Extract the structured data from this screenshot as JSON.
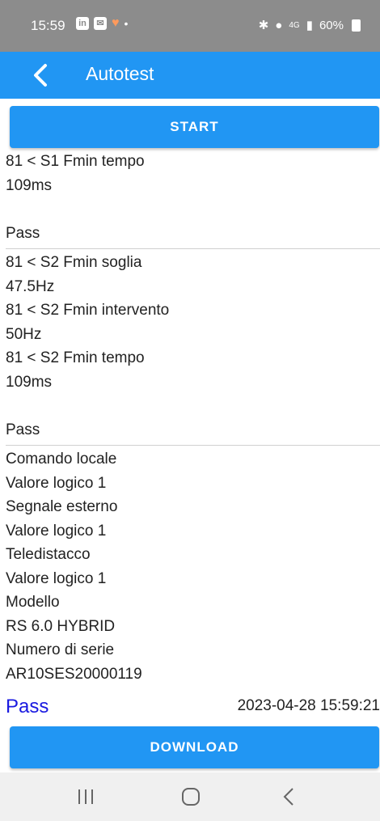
{
  "status_bar": {
    "time": "15:59",
    "left_icons": [
      "linkedin-icon",
      "message-icon",
      "heart-icon",
      "dot-icon"
    ],
    "signal_text": "4G",
    "battery": "60%"
  },
  "app_bar": {
    "title": "Autotest",
    "back_icon": "chevron-left-icon",
    "color": "#2196f3"
  },
  "start_button": {
    "label": "START"
  },
  "log": [
    "81 < S1 Fmin tempo",
    "109ms",
    "",
    "Pass",
    "---",
    "81 < S2 Fmin soglia",
    "47.5Hz",
    "81 < S2 Fmin intervento",
    "50Hz",
    "81 < S2 Fmin tempo",
    "109ms",
    "",
    "Pass",
    "---",
    "Comando locale",
    "Valore logico 1",
    "Segnale esterno",
    "Valore logico 1",
    "Teledistacco",
    "Valore logico 1",
    "Modello",
    "RS 6.0 HYBRID",
    "Numero di serie",
    "AR10SES20000119"
  ],
  "result": {
    "status": "Pass",
    "timestamp": "2023-04-28 15:59:21",
    "status_color": "#1a1ae0"
  },
  "download_button": {
    "label": "DOWNLOAD"
  },
  "nav_bar": {
    "icons": [
      "recent-apps-icon",
      "home-icon",
      "back-icon"
    ]
  }
}
